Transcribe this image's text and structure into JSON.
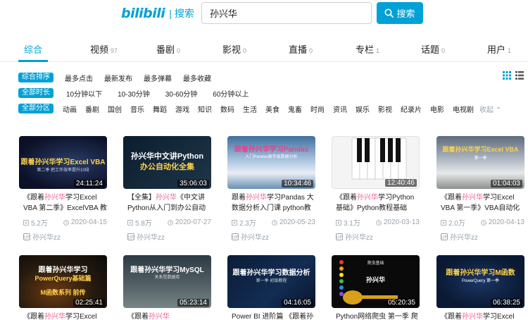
{
  "header": {
    "logo_text": "bilibili",
    "logo_separator": "|",
    "logo_sub": "搜索",
    "search_value": "孙兴华",
    "search_button": "搜索"
  },
  "tabs": [
    {
      "label": "综合",
      "count": ""
    },
    {
      "label": "视频",
      "count": "97"
    },
    {
      "label": "番剧",
      "count": "0"
    },
    {
      "label": "影视",
      "count": "0"
    },
    {
      "label": "直播",
      "count": "0"
    },
    {
      "label": "专栏",
      "count": "1"
    },
    {
      "label": "话题",
      "count": "0"
    },
    {
      "label": "用户",
      "count": "1"
    }
  ],
  "filters": {
    "sort": {
      "active": "综合排序",
      "options": [
        "最多点击",
        "最新发布",
        "最多弹幕",
        "最多收藏"
      ]
    },
    "duration": {
      "active": "全部时长",
      "options": [
        "10分钟以下",
        "10-30分钟",
        "30-60分钟",
        "60分钟以上"
      ]
    },
    "zone": {
      "active": "全部分区",
      "options": [
        "动画",
        "番剧",
        "国创",
        "音乐",
        "舞蹈",
        "游戏",
        "知识",
        "数码",
        "生活",
        "美食",
        "鬼畜",
        "时尚",
        "资讯",
        "娱乐",
        "影视",
        "纪录片",
        "电影",
        "电视剧"
      ],
      "collapse": "收起"
    }
  },
  "videos": [
    {
      "duration": "24:11:24",
      "title": "《跟着孙兴华学习Excel VBA 第二季》ExcelVBA 教",
      "views": "5.2万",
      "date": "2020-04-15",
      "uploader": "孙兴华zz",
      "thumb_line1": "跟着孙兴华学习Excel VBA",
      "thumb_line2": "第二季 把工作效率提升10倍"
    },
    {
      "duration": "35:06:03",
      "title": "【全集】孙兴华《中文讲Python从入门到办公自动",
      "views": "5.8万",
      "date": "2020-07-27",
      "uploader": "孙兴华zz",
      "thumb_line1": "孙兴华中文讲Python",
      "thumb_line2": "办公自动化全集"
    },
    {
      "duration": "10:34:46",
      "title": "跟着孙兴华学习Pandas 大数据分析入门课 python教程",
      "views": "2.3万",
      "date": "2020-05-23",
      "uploader": "孙兴华zz",
      "thumb_line1": "跟着孙兴华学习Pandas",
      "thumb_line2": "入门Pandas高手级数据分析"
    },
    {
      "duration": "12:40:46",
      "title": "《跟着孙兴华学习Python基础》Python教程基础【本",
      "views": "3.1万",
      "date": "2020-03-13",
      "uploader": "孙兴华zz",
      "thumb_line1": "",
      "thumb_line2": ""
    },
    {
      "duration": "01:04:03",
      "title": "《跟着孙兴华学习Excel VBA 第一季》VBA自动化程",
      "views": "2.0万",
      "date": "2020-04-13",
      "uploader": "孙兴华zz",
      "thumb_line1": "跟着孙兴华学习Excel VBA",
      "thumb_line2": "第一季"
    },
    {
      "duration": "02:25:41",
      "title": "《跟着孙兴华学习Excel",
      "views": "",
      "date": "",
      "uploader": "",
      "thumb_line1": "跟着孙兴华学习",
      "thumb_line2": "PowerQuery基础篇",
      "thumb_line3": "M函数系列 前传"
    },
    {
      "duration": "05:23:14",
      "title": "《跟着孙兴华学习MySQL》",
      "views": "",
      "date": "",
      "uploader": "",
      "thumb_line1": "跟着孙兴华学习MySQL",
      "thumb_line2": "关系型数据库"
    },
    {
      "duration": "04:16:05",
      "title": "Power BI 进阶篇 《跟着孙",
      "views": "",
      "date": "",
      "uploader": "",
      "thumb_line1": "跟着孙兴华学习数据分析",
      "thumb_line2": "第一季 初级教程"
    },
    {
      "duration": "05:20:35",
      "title": "Python网络爬虫 第一季 爬",
      "views": "",
      "date": "",
      "uploader": "",
      "thumb_line1": "爬虫基础",
      "thumb_line2": "孙兴华"
    },
    {
      "duration": "06:38:25",
      "title": "《跟着孙兴华学习Excel",
      "views": "",
      "date": "",
      "uploader": "",
      "thumb_line1": "跟着孙兴华学习M函数",
      "thumb_line2": "PowerQuery 第一季"
    }
  ],
  "colors": {
    "accent": "#00a1d6",
    "highlight": "#f25d8e",
    "muted": "#99a2aa"
  }
}
